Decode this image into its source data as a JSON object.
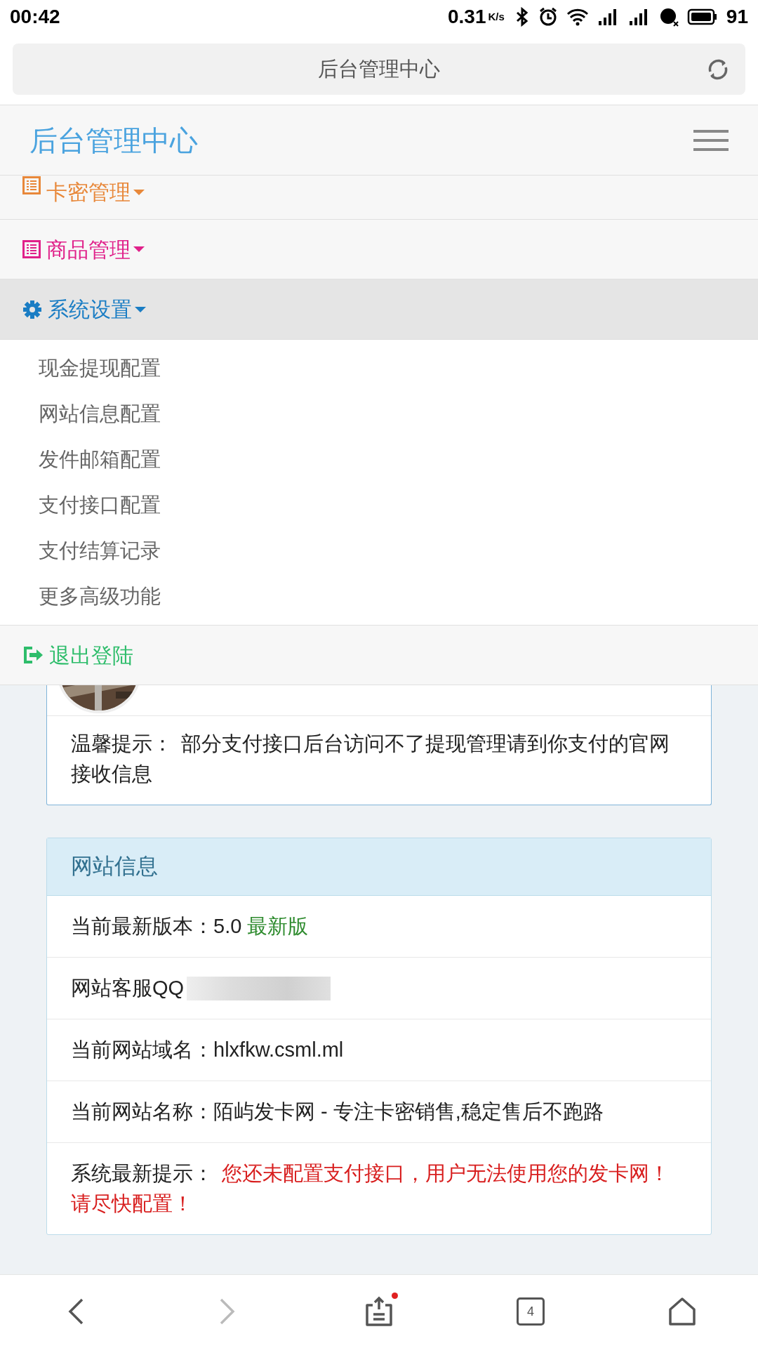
{
  "status_bar": {
    "time": "00:42",
    "speed": "0.31",
    "speed_unit": "K/s",
    "battery": "91"
  },
  "address_bar": {
    "title": "后台管理中心"
  },
  "header": {
    "title": "后台管理中心"
  },
  "menu": [
    {
      "kind": "list",
      "label": "卡密管理",
      "color": "#e8883a",
      "expanded": false
    },
    {
      "kind": "list",
      "label": "商品管理",
      "color": "#e0218a",
      "expanded": false
    },
    {
      "kind": "gear",
      "label": "系统设置",
      "color": "#1a7dc4",
      "expanded": true,
      "children": [
        "现金提现配置",
        "网站信息配置",
        "发件邮箱配置",
        "支付接口配置",
        "支付结算记录",
        "更多高级功能"
      ]
    },
    {
      "kind": "logout",
      "label": "退出登陆",
      "color": "#2ebd6b",
      "expanded": false
    }
  ],
  "notice_card": {
    "label": "温馨提示：",
    "text": "部分支付接口后台访问不了提现管理请到你支付的官网接收信息"
  },
  "site_info": {
    "title": "网站信息",
    "rows": [
      {
        "label": "当前最新版本：",
        "value": "5.0",
        "badge": "最新版"
      },
      {
        "label": "网站客服QQ",
        "redacted": true
      },
      {
        "label": "当前网站域名：",
        "value": "hlxfkw.csml.ml"
      },
      {
        "label": "当前网站名称：",
        "value": "陌屿发卡网 - 专注卡密销售,稳定售后不跑路"
      },
      {
        "label": "系统最新提示：",
        "alert": "您还未配置支付接口，用户无法使用您的发卡网！请尽快配置！"
      }
    ]
  },
  "bottom_nav": {
    "tab_count": "4",
    "share_badge": true
  }
}
